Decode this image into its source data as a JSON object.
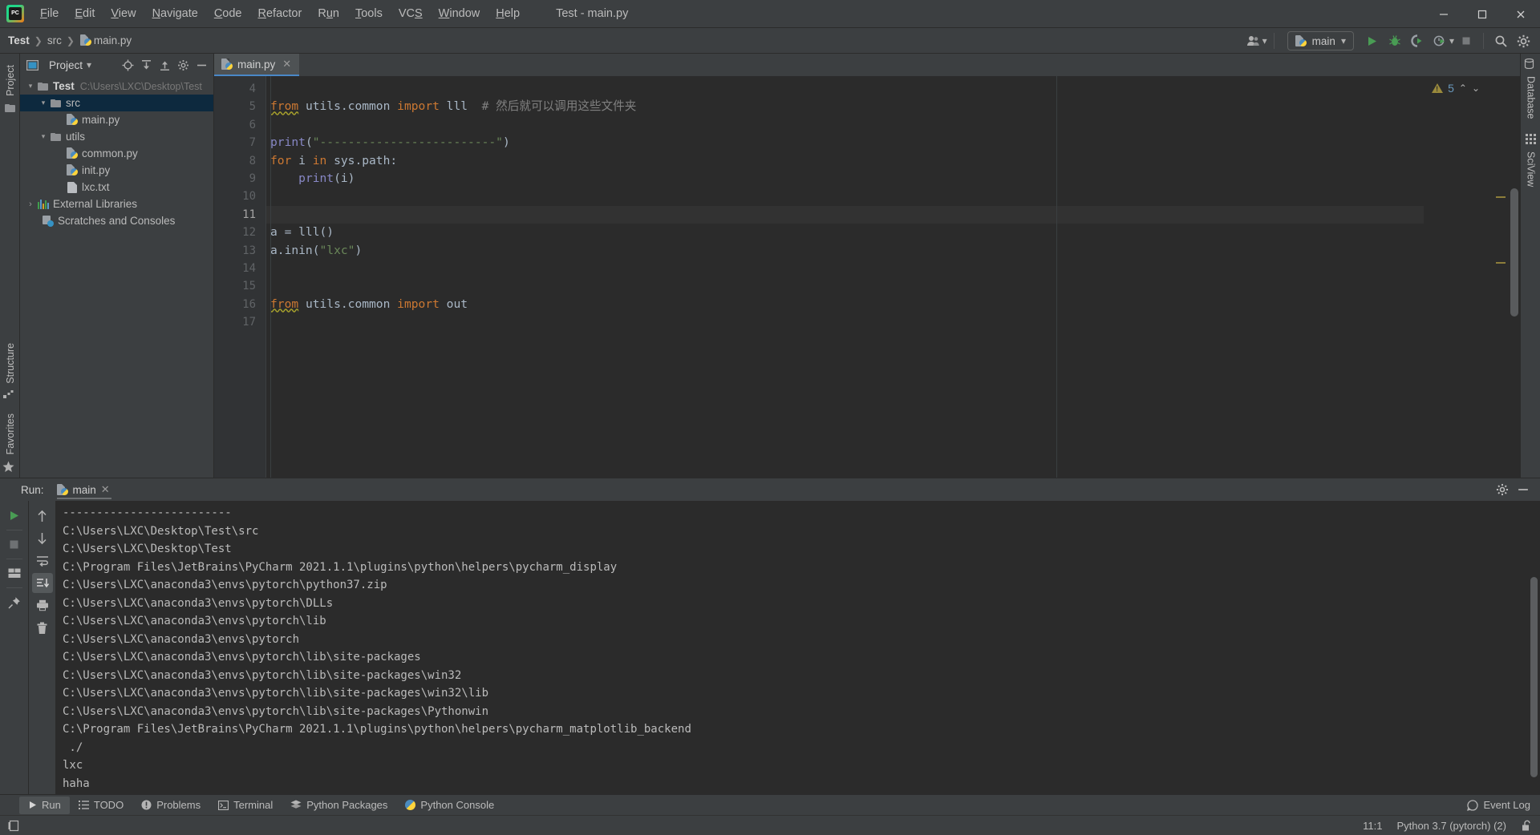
{
  "window": {
    "title": "Test - main.py",
    "app_icon": "pycharm-logo-icon",
    "minimize_label": "–",
    "maximize_label": "❐",
    "close_label": "✕"
  },
  "menubar": {
    "items": [
      {
        "label": "File",
        "mnemonic": "F"
      },
      {
        "label": "Edit",
        "mnemonic": "E"
      },
      {
        "label": "View",
        "mnemonic": "V"
      },
      {
        "label": "Navigate",
        "mnemonic": "N"
      },
      {
        "label": "Code",
        "mnemonic": "C"
      },
      {
        "label": "Refactor",
        "mnemonic": "R"
      },
      {
        "label": "Run",
        "mnemonic": "u"
      },
      {
        "label": "Tools",
        "mnemonic": "T"
      },
      {
        "label": "VCS",
        "mnemonic": "S"
      },
      {
        "label": "Window",
        "mnemonic": "W"
      },
      {
        "label": "Help",
        "mnemonic": "H"
      }
    ]
  },
  "navbar": {
    "breadcrumb": [
      "Test",
      "src",
      "main.py"
    ],
    "breadcrumb_file_icon": "python-file-icon",
    "account_icon": "user-account-icon",
    "run_config": {
      "label": "main",
      "icon": "python-file-icon",
      "dropdown": "▾"
    },
    "actions": [
      {
        "name": "run-button",
        "icon": "run-triangle-icon"
      },
      {
        "name": "debug-button",
        "icon": "debug-bug-icon"
      },
      {
        "name": "run-coverage-button",
        "icon": "run-with-coverage-icon"
      },
      {
        "name": "profile-button",
        "icon": "profiler-clock-icon"
      },
      {
        "name": "stop-button",
        "icon": "stop-square-icon"
      },
      {
        "name": "search-everywhere-button",
        "icon": "search-icon"
      },
      {
        "name": "settings-button",
        "icon": "gear-icon"
      }
    ]
  },
  "left_rail": {
    "top_tab": {
      "label": "Project",
      "icon": "project-folder-icon"
    },
    "bottom_tabs": [
      {
        "label": "Structure",
        "icon": "structure-icon"
      },
      {
        "label": "Favorites",
        "icon": "star-icon"
      }
    ]
  },
  "right_rail": {
    "tabs": [
      {
        "label": "Database",
        "icon": "database-icon"
      },
      {
        "label": "SciView",
        "icon": "sciview-grid-icon"
      }
    ]
  },
  "project_panel": {
    "title": "Project",
    "dropdown": "▾",
    "toolbar_icons": [
      {
        "name": "locate-target-icon"
      },
      {
        "name": "expand-all-icon"
      },
      {
        "name": "collapse-all-icon"
      },
      {
        "name": "panel-settings-gear-icon"
      },
      {
        "name": "hide-panel-icon"
      }
    ],
    "tree": [
      {
        "label": "Test",
        "path": "C:\\Users\\LXC\\Desktop\\Test",
        "icon": "folder-icon",
        "indent": 0,
        "twist": "⌄",
        "bold": true,
        "selected": false
      },
      {
        "label": "src",
        "path": "",
        "icon": "folder-icon",
        "indent": 1,
        "twist": "⌄",
        "bold": false,
        "selected": true
      },
      {
        "label": "main.py",
        "path": "",
        "icon": "python-file-icon",
        "indent": 2,
        "twist": "",
        "bold": false,
        "selected": false
      },
      {
        "label": "utils",
        "path": "",
        "icon": "folder-icon",
        "indent": 1,
        "twist": "⌄",
        "bold": false,
        "selected": false
      },
      {
        "label": "common.py",
        "path": "",
        "icon": "python-file-icon",
        "indent": 2,
        "twist": "",
        "bold": false,
        "selected": false
      },
      {
        "label": "init.py",
        "path": "",
        "icon": "python-file-icon",
        "indent": 2,
        "twist": "",
        "bold": false,
        "selected": false
      },
      {
        "label": "lxc.txt",
        "path": "",
        "icon": "text-file-icon",
        "indent": 2,
        "twist": "",
        "bold": false,
        "selected": false
      },
      {
        "label": "External Libraries",
        "path": "",
        "icon": "libraries-icon",
        "indent": 0,
        "twist": "›",
        "bold": false,
        "selected": false
      },
      {
        "label": "Scratches and Consoles",
        "path": "",
        "icon": "scratches-icon",
        "indent": 0,
        "twist": "",
        "bold": false,
        "selected": false
      }
    ]
  },
  "editor": {
    "tabs": [
      {
        "label": "main.py",
        "icon": "python-file-icon",
        "close": "✕",
        "active": true
      }
    ],
    "first_line_number": 4,
    "current_line": 11,
    "lines": [
      {
        "n": 4,
        "tokens": []
      },
      {
        "n": 5,
        "tokens": [
          {
            "t": "from",
            "c": "kw err"
          },
          {
            "t": " utils.common ",
            "c": "fn"
          },
          {
            "t": "import",
            "c": "kw"
          },
          {
            "t": " lll  ",
            "c": "fn"
          },
          {
            "t": "# 然后就可以调用这些文件夹",
            "c": "com"
          }
        ]
      },
      {
        "n": 6,
        "tokens": []
      },
      {
        "n": 7,
        "tokens": [
          {
            "t": "print",
            "c": "pfn"
          },
          {
            "t": "(",
            "c": "fn"
          },
          {
            "t": "\"-------------------------\"",
            "c": "str"
          },
          {
            "t": ")",
            "c": "fn"
          }
        ]
      },
      {
        "n": 8,
        "tokens": [
          {
            "t": "for",
            "c": "kw"
          },
          {
            "t": " i ",
            "c": "fn"
          },
          {
            "t": "in",
            "c": "kw"
          },
          {
            "t": " sys.path:",
            "c": "fn"
          }
        ]
      },
      {
        "n": 9,
        "tokens": [
          {
            "t": "    ",
            "c": "fn"
          },
          {
            "t": "print",
            "c": "pfn"
          },
          {
            "t": "(i)",
            "c": "fn"
          }
        ]
      },
      {
        "n": 10,
        "tokens": []
      },
      {
        "n": 11,
        "tokens": [],
        "current": true
      },
      {
        "n": 12,
        "tokens": [
          {
            "t": "a = lll()",
            "c": "fn"
          }
        ]
      },
      {
        "n": 13,
        "tokens": [
          {
            "t": "a.inin(",
            "c": "fn"
          },
          {
            "t": "\"lxc\"",
            "c": "str"
          },
          {
            "t": ")",
            "c": "fn"
          }
        ]
      },
      {
        "n": 14,
        "tokens": []
      },
      {
        "n": 15,
        "tokens": []
      },
      {
        "n": 16,
        "tokens": [
          {
            "t": "from",
            "c": "kw err"
          },
          {
            "t": " utils.common ",
            "c": "fn"
          },
          {
            "t": "import",
            "c": "kw"
          },
          {
            "t": " out",
            "c": "fn"
          }
        ]
      },
      {
        "n": 17,
        "tokens": []
      }
    ],
    "inspection": {
      "icon": "warning-triangle-icon",
      "count": "5",
      "prev": "⌃",
      "next": "⌄"
    }
  },
  "run_panel": {
    "label": "Run:",
    "tab": {
      "label": "main",
      "icon": "python-file-icon",
      "close": "✕"
    },
    "header_icons": [
      {
        "name": "run-panel-settings-gear-icon"
      },
      {
        "name": "hide-run-panel-icon"
      }
    ],
    "left_tools": [
      {
        "name": "rerun-button",
        "icon": "run-triangle-icon"
      },
      {
        "name": "stop-button",
        "icon": "stop-square-icon"
      },
      {
        "name": "layout-button",
        "icon": "restore-layout-icon"
      },
      {
        "name": "pin-tab-button",
        "icon": "pin-icon"
      }
    ],
    "right_tools": [
      {
        "name": "up-stacktrace-button",
        "icon": "arrow-up-icon"
      },
      {
        "name": "down-stacktrace-button",
        "icon": "arrow-down-icon"
      },
      {
        "name": "soft-wrap-button",
        "icon": "soft-wrap-icon"
      },
      {
        "name": "scroll-to-end-button",
        "icon": "scroll-to-end-icon",
        "active": true
      },
      {
        "name": "print-button",
        "icon": "printer-icon"
      },
      {
        "name": "clear-all-button",
        "icon": "trash-icon"
      }
    ],
    "console_lines": [
      "-------------------------",
      "C:\\Users\\LXC\\Desktop\\Test\\src",
      "C:\\Users\\LXC\\Desktop\\Test",
      "C:\\Program Files\\JetBrains\\PyCharm 2021.1.1\\plugins\\python\\helpers\\pycharm_display",
      "C:\\Users\\LXC\\anaconda3\\envs\\pytorch\\python37.zip",
      "C:\\Users\\LXC\\anaconda3\\envs\\pytorch\\DLLs",
      "C:\\Users\\LXC\\anaconda3\\envs\\pytorch\\lib",
      "C:\\Users\\LXC\\anaconda3\\envs\\pytorch",
      "C:\\Users\\LXC\\anaconda3\\envs\\pytorch\\lib\\site-packages",
      "C:\\Users\\LXC\\anaconda3\\envs\\pytorch\\lib\\site-packages\\win32",
      "C:\\Users\\LXC\\anaconda3\\envs\\pytorch\\lib\\site-packages\\win32\\lib",
      "C:\\Users\\LXC\\anaconda3\\envs\\pytorch\\lib\\site-packages\\Pythonwin",
      "C:\\Program Files\\JetBrains\\PyCharm 2021.1.1\\plugins\\python\\helpers\\pycharm_matplotlib_backend",
      " ./",
      "lxc",
      "haha"
    ]
  },
  "toolwindow_bar": {
    "items": [
      {
        "label": "Run",
        "icon": "run-triangle-icon",
        "active": true
      },
      {
        "label": "TODO",
        "icon": "todo-list-icon",
        "active": false
      },
      {
        "label": "Problems",
        "icon": "problems-icon",
        "active": false
      },
      {
        "label": "Terminal",
        "icon": "terminal-icon",
        "active": false
      },
      {
        "label": "Python Packages",
        "icon": "packages-icon",
        "active": false
      },
      {
        "label": "Python Console",
        "icon": "python-console-icon",
        "active": false
      }
    ],
    "event_log": {
      "label": "Event Log",
      "icon": "event-log-icon"
    }
  },
  "statusbar": {
    "left_icon": "toggle-sidebar-icon",
    "caret_position": "11:1",
    "interpreter": "Python 3.7 (pytorch) (2)",
    "lock_icon": "unlocked-padlock-icon"
  },
  "colors": {
    "panel_bg": "#3c3f41",
    "editor_bg": "#2b2b2b",
    "gutter_bg": "#313335",
    "selection_blue": "#0d293e",
    "tab_underline": "#4a88c7",
    "keyword_orange": "#cc7832",
    "string_green": "#6a8759",
    "builtin_purple": "#8888c6",
    "comment_gray": "#808080",
    "text": "#bbbbbb",
    "run_green": "#499c54"
  }
}
